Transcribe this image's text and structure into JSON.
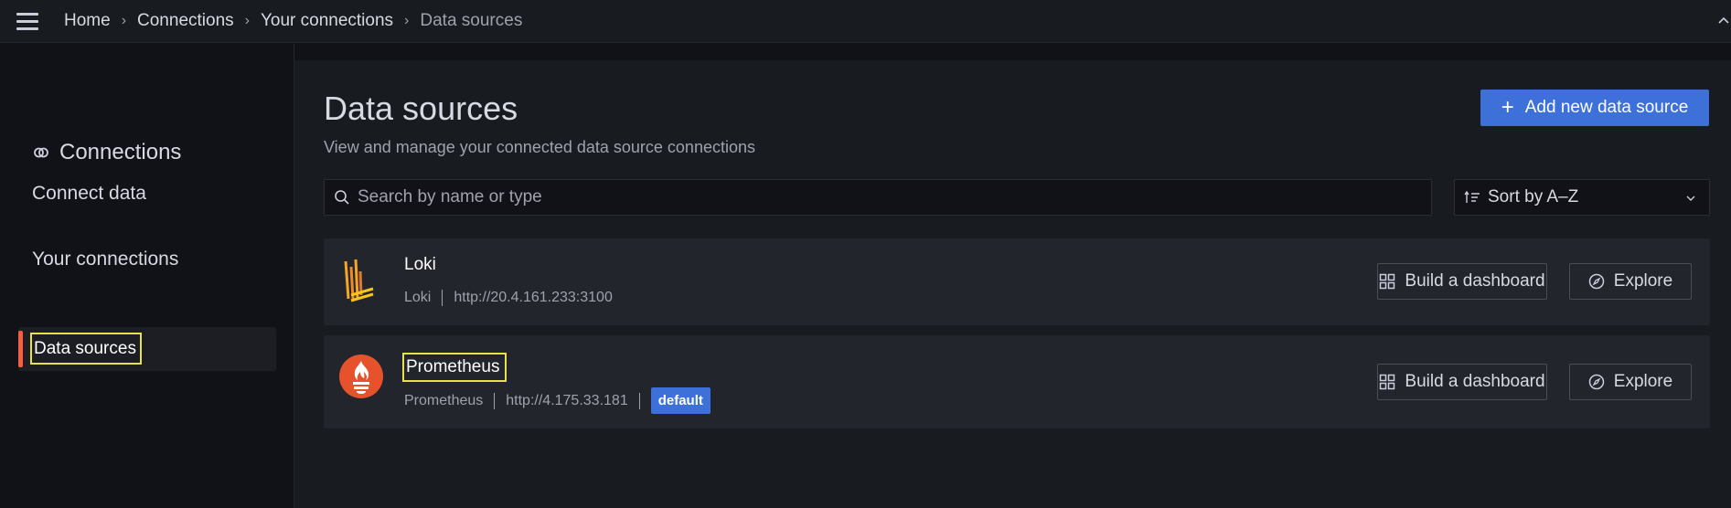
{
  "topbar": {
    "breadcrumb": [
      "Home",
      "Connections",
      "Your connections",
      "Data sources"
    ],
    "separator": "›",
    "icons": {
      "menu": "hamburger-menu-icon",
      "collapse": "chevron-up-icon"
    }
  },
  "sidebar": {
    "title": "Connections",
    "title_icon": "connections-icon",
    "connect_data": "Connect data",
    "your_connections": "Your connections",
    "active_item": "Data sources",
    "accent_color": "#f55f3e"
  },
  "page": {
    "title": "Data sources",
    "subtitle": "View and manage your connected data source connections",
    "add_button": "Add new data source",
    "add_icon": "+",
    "search_placeholder": "Search by name or type",
    "sort_label": "Sort by A–Z",
    "primary_color": "#3d71d9"
  },
  "datasources": [
    {
      "name": "Loki",
      "type": "Loki",
      "url": "http://20.4.161.233:3100",
      "logo": "loki-logo-icon",
      "dashboard_button": "Build a dashboard",
      "explore_button": "Explore"
    },
    {
      "name": "Prometheus",
      "type": "Prometheus",
      "url": "http://4.175.33.181",
      "badge": "default",
      "logo": "prometheus-logo-icon",
      "dashboard_button": "Build a dashboard",
      "explore_button": "Explore"
    }
  ]
}
